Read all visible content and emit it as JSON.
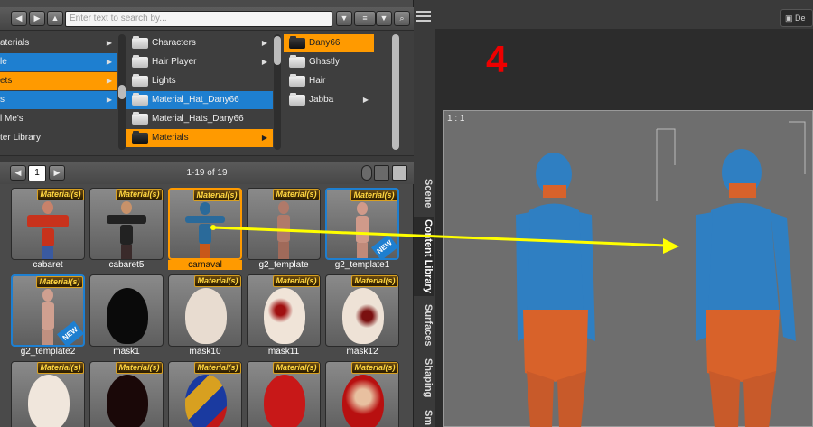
{
  "search": {
    "placeholder": "Enter text to search by..."
  },
  "columns": {
    "col1": [
      {
        "label": "aterials",
        "state": "normal"
      },
      {
        "label": "le",
        "state": "blue"
      },
      {
        "label": "ets",
        "state": "orange"
      },
      {
        "label": "s",
        "state": "blue"
      },
      {
        "label": "l Me's",
        "state": "normal"
      },
      {
        "label": "ter Library",
        "state": "normal"
      }
    ],
    "col2": [
      {
        "label": "Characters",
        "state": "normal"
      },
      {
        "label": "Hair Player",
        "state": "normal"
      },
      {
        "label": "Lights",
        "state": "normal"
      },
      {
        "label": "Material_Hat_Dany66",
        "state": "blue"
      },
      {
        "label": "Material_Hats_Dany66",
        "state": "normal"
      },
      {
        "label": "Materials",
        "state": "orange"
      }
    ],
    "col3": [
      {
        "label": "Dany66",
        "state": "orange"
      },
      {
        "label": "Ghastly",
        "state": "normal"
      },
      {
        "label": "Hair",
        "state": "normal"
      },
      {
        "label": "Jabba",
        "state": "normal"
      }
    ]
  },
  "pagination": {
    "page": "1",
    "count": "1-19 of 19"
  },
  "tag_label": "Material(s)",
  "new_label": "NEW",
  "items": [
    {
      "name": "cabaret"
    },
    {
      "name": "cabaret5"
    },
    {
      "name": "carnaval"
    },
    {
      "name": "g2_template"
    },
    {
      "name": "g2_template1"
    },
    {
      "name": "g2_template2"
    },
    {
      "name": "mask1"
    },
    {
      "name": "mask10"
    },
    {
      "name": "mask11"
    },
    {
      "name": "mask12"
    },
    {
      "name": ""
    },
    {
      "name": ""
    },
    {
      "name": ""
    },
    {
      "name": ""
    },
    {
      "name": ""
    }
  ],
  "side_tabs": {
    "scene": "Scene",
    "content_library": "Content Library",
    "surfaces": "Surfaces",
    "shaping": "Shaping",
    "smoothing": "Sm"
  },
  "viewport": {
    "step": "4",
    "ratio": "1 : 1",
    "default_button": "De"
  },
  "colors": {
    "accent_orange": "#ff9a00",
    "accent_blue": "#1e7fd0",
    "annotation_yellow": "#ffff00",
    "step_red": "#e00000"
  }
}
